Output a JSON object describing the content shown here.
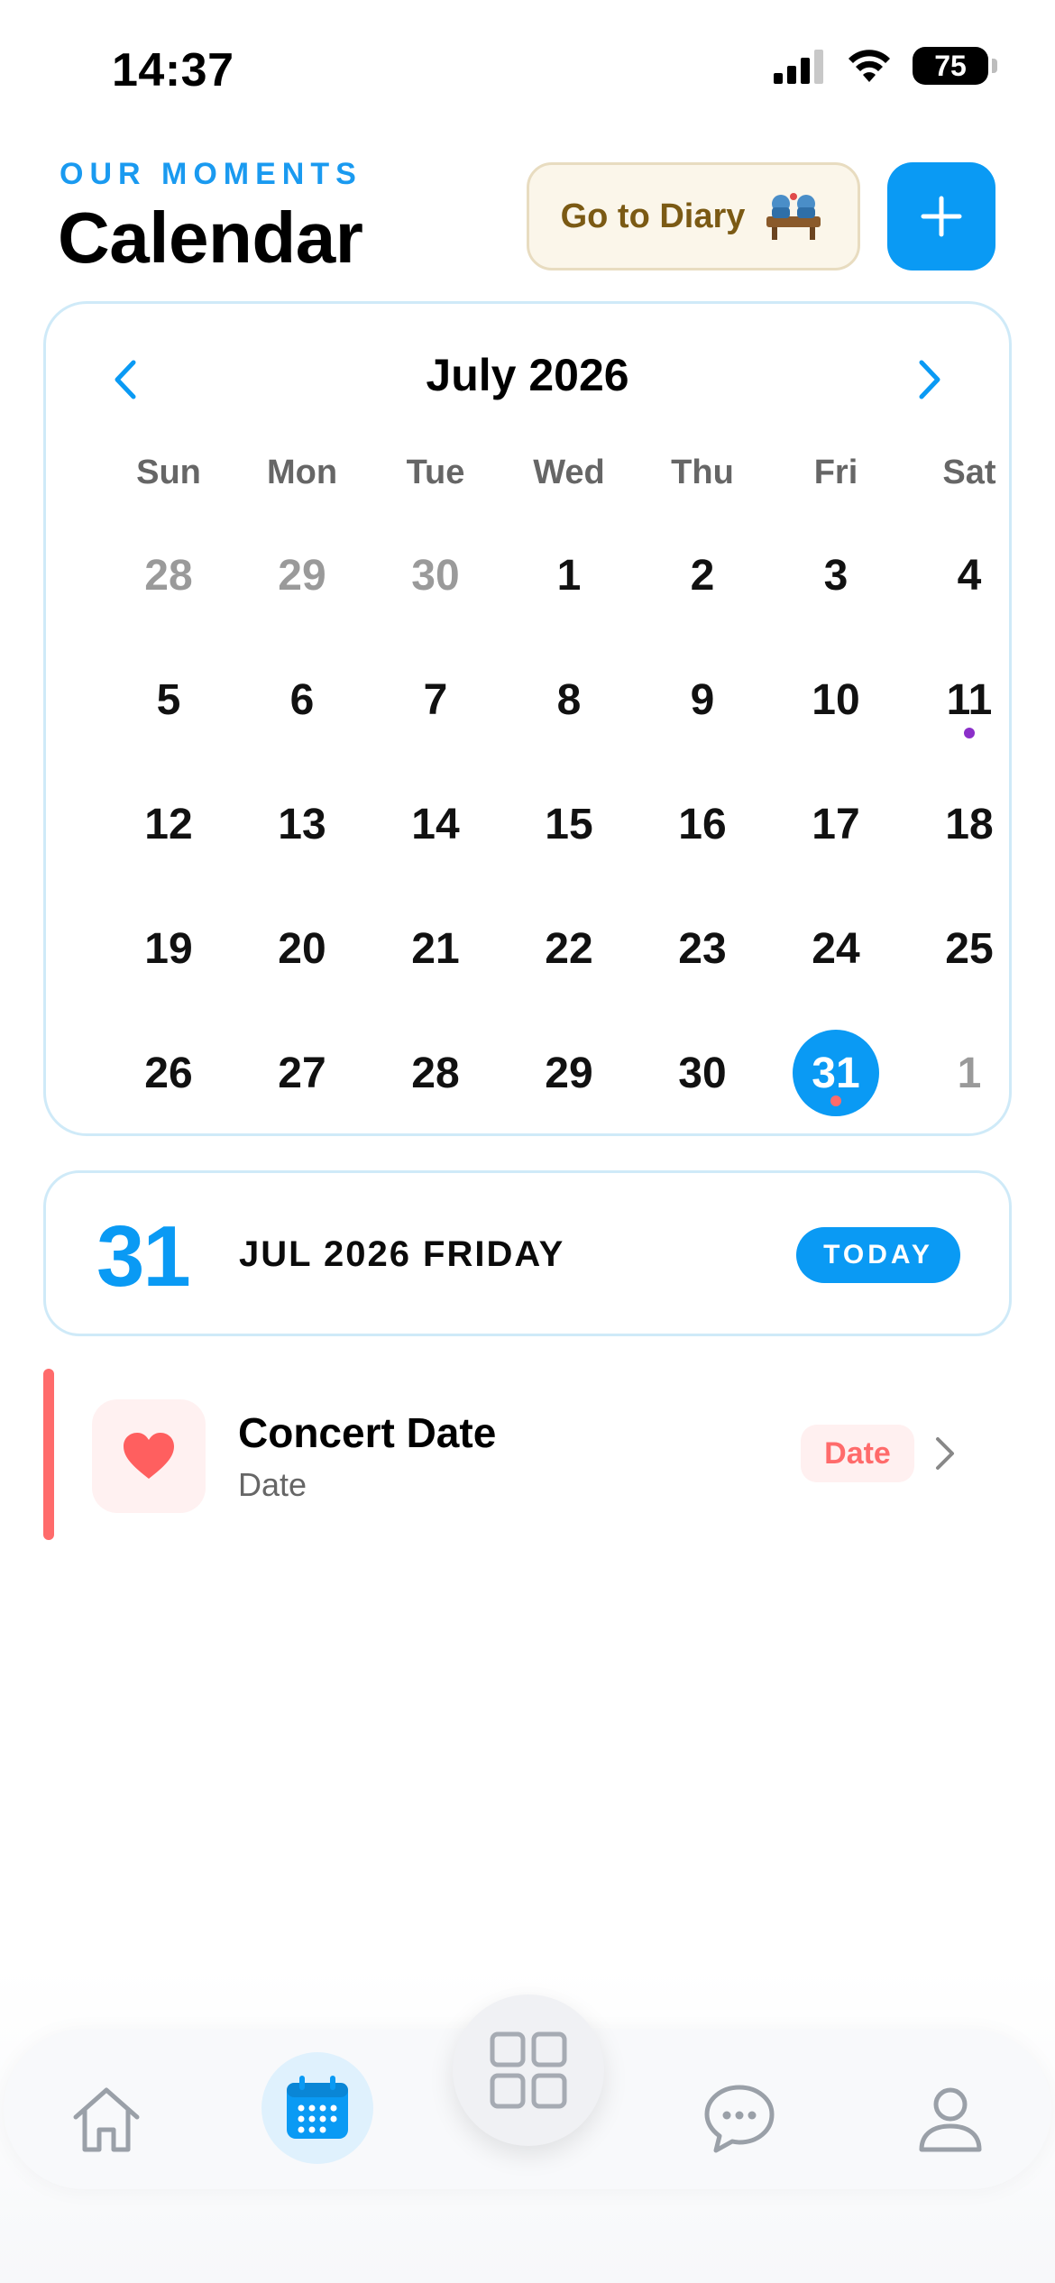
{
  "status_bar": {
    "time": "14:37",
    "battery": "75"
  },
  "header": {
    "eyebrow": "OUR MOMENTS",
    "title": "Calendar",
    "diary_button_label": "Go to Diary",
    "add_button_icon": "plus-icon"
  },
  "calendar": {
    "month_label": "July 2026",
    "prev_icon": "chevron-left-icon",
    "next_icon": "chevron-right-icon",
    "weekdays": [
      "Sun",
      "Mon",
      "Tue",
      "Wed",
      "Thu",
      "Fri",
      "Sat"
    ],
    "weeks": [
      [
        "28",
        "29",
        "30",
        "1",
        "2",
        "3",
        "4"
      ],
      [
        "5",
        "6",
        "7",
        "8",
        "9",
        "10",
        "11"
      ],
      [
        "12",
        "13",
        "14",
        "15",
        "16",
        "17",
        "18"
      ],
      [
        "19",
        "20",
        "21",
        "22",
        "23",
        "24",
        "25"
      ],
      [
        "26",
        "27",
        "28",
        "29",
        "30",
        "31",
        "1"
      ]
    ],
    "selected_day": "31",
    "event_markers": [
      {
        "day": "11",
        "color": "#8b2fc9"
      },
      {
        "day": "31",
        "color": "#ff6b6b"
      }
    ]
  },
  "selected_date": {
    "day": "31",
    "label": "JUL 2026 FRIDAY",
    "badge": "TODAY"
  },
  "events": [
    {
      "title": "Concert Date",
      "subtitle": "Date",
      "tag": "Date",
      "icon": "heart-icon",
      "color": "#ff6b6b"
    }
  ],
  "bottom_nav": {
    "items": [
      {
        "name": "home",
        "icon": "home-icon",
        "active": false
      },
      {
        "name": "calendar",
        "icon": "calendar-icon",
        "active": true
      },
      {
        "name": "menu",
        "icon": "grid-icon",
        "active": false
      },
      {
        "name": "chat",
        "icon": "chat-icon",
        "active": false
      },
      {
        "name": "profile",
        "icon": "user-icon",
        "active": false
      }
    ]
  },
  "colors": {
    "accent": "#0a9af4",
    "event_red": "#ff6b6b",
    "marker_purple": "#8b2fc9",
    "diary_text": "#7b5a14"
  }
}
